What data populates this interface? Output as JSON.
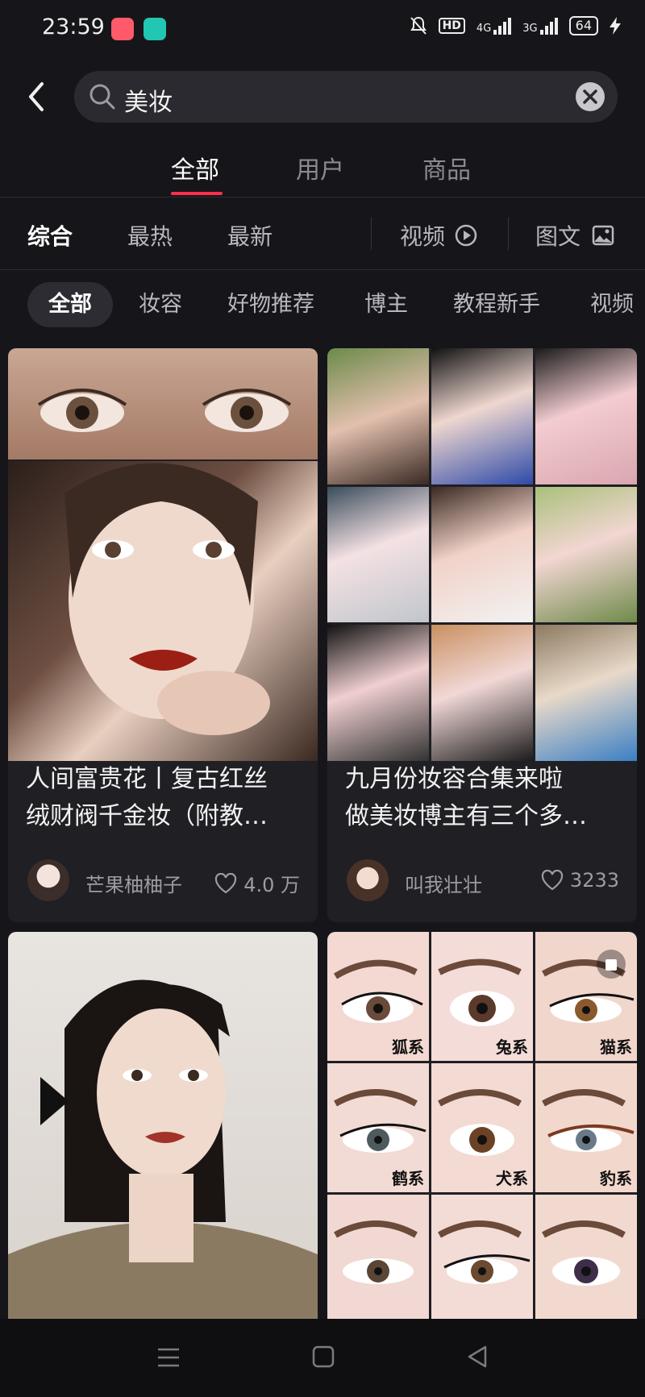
{
  "status_bar": {
    "time": "23:59",
    "hd": "HD",
    "net1": "4G",
    "net2": "3G",
    "battery": "64",
    "icons": [
      "app-icon-pink",
      "app-icon-teal",
      "mute-bell-icon",
      "signal-icon",
      "lightning-icon"
    ]
  },
  "search": {
    "query": "美妆"
  },
  "main_tabs": [
    {
      "label": "全部",
      "active": true
    },
    {
      "label": "用户",
      "active": false
    },
    {
      "label": "商品",
      "active": false
    }
  ],
  "filter_row": {
    "items": [
      "综合",
      "最热",
      "最新"
    ],
    "video": "视频",
    "image_text": "图文"
  },
  "chips": [
    "全部",
    "妆容",
    "好物推荐",
    "博主",
    "教程新手",
    "视频"
  ],
  "cards": [
    {
      "title_line1": "人间富贵花丨复古红丝",
      "title_line2": "绒财阀千金妆（附教…",
      "author": "芒果柚柚子",
      "likes": "4.0 万"
    },
    {
      "title_line1": "九月份妆容合集来啦",
      "title_line2": "做美妆博主有三个多…",
      "author": "叫我壮壮",
      "likes": "3233"
    }
  ],
  "eye_labels": [
    "狐系",
    "兔系",
    "猫系",
    "鹤系",
    "犬系",
    "豹系"
  ],
  "colors": {
    "accent": "#ff2e4d",
    "background": "#16161a",
    "card": "#1f1f24"
  }
}
